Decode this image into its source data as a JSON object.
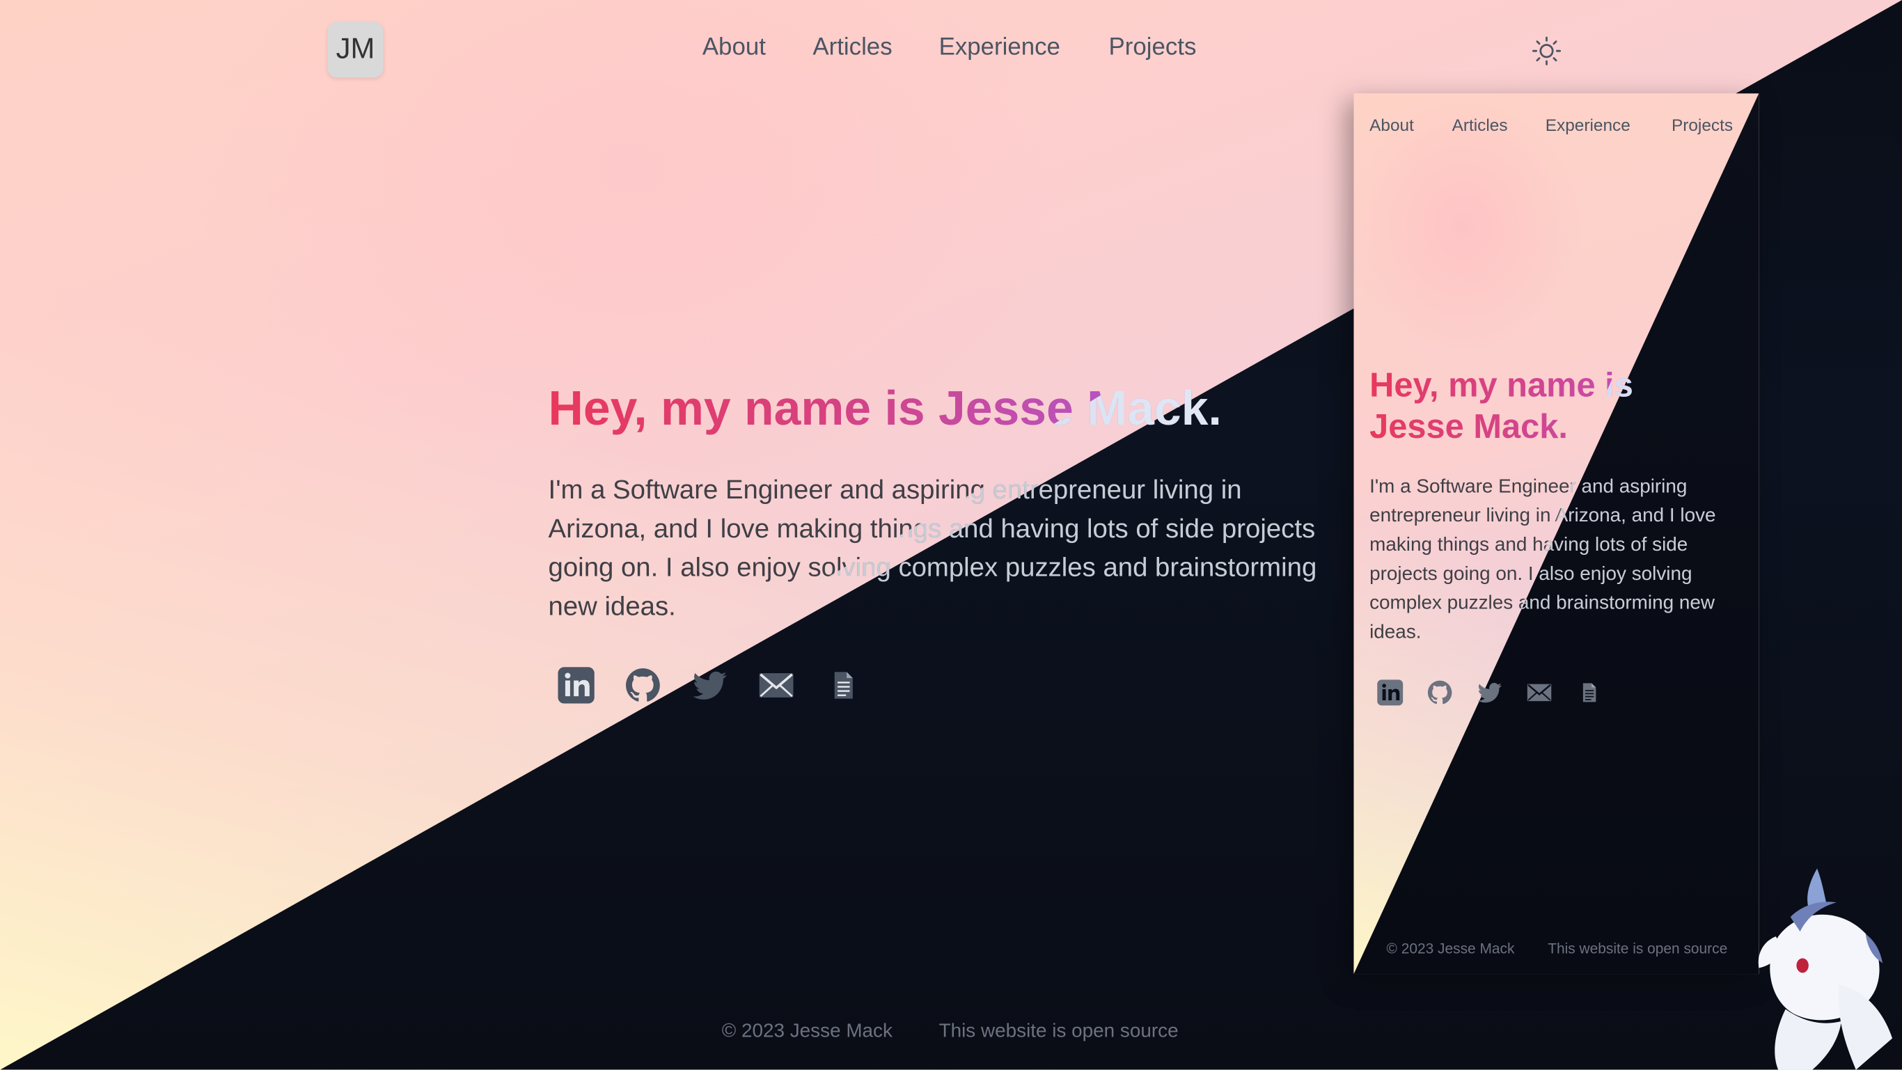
{
  "header": {
    "logo_text": "JM",
    "nav": [
      "About",
      "Articles",
      "Experience",
      "Projects"
    ],
    "theme_icon": "sun-icon"
  },
  "hero": {
    "title": "Hey, my name is Jesse Mack.",
    "paragraph": "I'm a Software Engineer and aspiring entrepreneur living in Arizona, and I love making things and having lots of side projects going on. I also enjoy solving complex puzzles and brainstorming new ideas.",
    "paragraph_lines": [
      "I'm a Software Engineer and aspiring entrepreneur living in",
      "Arizona, and I love making things and having lots of side projects",
      "going on. I also enjoy solving complex puzzles and brainstorming",
      "new ideas."
    ],
    "social_icons": [
      "linkedin-icon",
      "github-icon",
      "twitter-icon",
      "email-icon",
      "resume-icon"
    ]
  },
  "footer": {
    "copyright": "© 2023 Jesse Mack",
    "open_source": "This website is open source"
  },
  "mobile_preview": {
    "nav": [
      "About",
      "Articles",
      "Experience",
      "Projects"
    ],
    "title_lines": [
      "Hey, my name is",
      "Jesse Mack."
    ],
    "paragraph_lines": [
      "I'm a Software Engineer and aspiring",
      "entrepreneur living in Arizona, and I love",
      "making things and having lots of side",
      "projects going on. I also enjoy solving",
      "complex puzzles and brainstorming new",
      "ideas."
    ],
    "footer": {
      "copyright": "© 2023 Jesse Mack",
      "open_source": "This website is open source"
    }
  },
  "colors": {
    "accent_start": "#e8395c",
    "accent_end": "#9a63d8",
    "dark_bg": "#0a0e18",
    "icon_gray": "#4b5563"
  }
}
